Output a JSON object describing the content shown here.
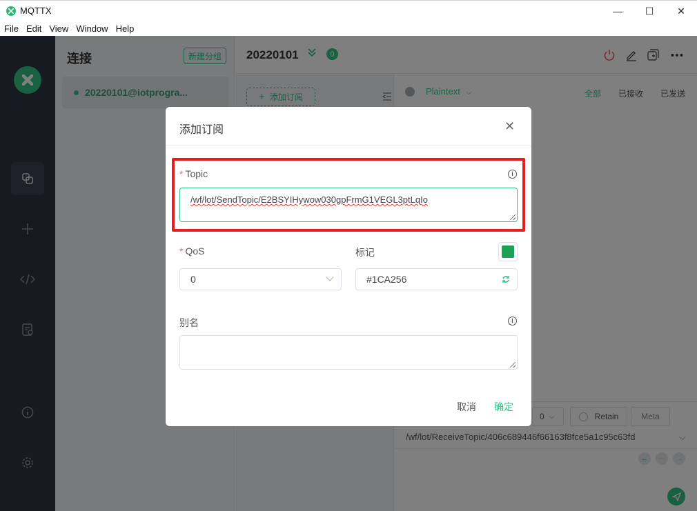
{
  "app": {
    "title": "MQTTX"
  },
  "window_controls": {
    "minimize": "—",
    "maximize": "☐",
    "close": "✕"
  },
  "menu": [
    "File",
    "Edit",
    "View",
    "Window",
    "Help"
  ],
  "connections": {
    "title": "连接",
    "new_group_label": "新建分组",
    "items": [
      {
        "name": "20220101@iotprogra...",
        "status_color": "#34c388"
      }
    ]
  },
  "main": {
    "title": "20220101",
    "subscription_count": "0",
    "add_subscription_label": "添加订阅",
    "payload_format": "Plaintext",
    "filters": [
      "全部",
      "已接收",
      "已发送"
    ],
    "composer": {
      "qos_value": "0",
      "retain_label": "Retain",
      "meta_label": "Meta",
      "topic": "/wf/lot/ReceiveTopic/406c689446f66163f8fce5a1c95c63fd"
    }
  },
  "dialog": {
    "title": "添加订阅",
    "topic_label": "Topic",
    "topic_value": "/wf/lot/SendTopic/E2BSYIHywow030gpFrmG1VEGL3ptLqIo",
    "qos_label": "QoS",
    "qos_value": "0",
    "color_label": "标记",
    "color_value": "#1CA256",
    "alias_label": "别名",
    "alias_value": "",
    "cancel_label": "取消",
    "confirm_label": "确定",
    "required_mark": "*"
  },
  "colors": {
    "accent": "#34c388",
    "highlight": "#e81e1e",
    "swatch": "#1CA256"
  },
  "icons": {
    "nav": [
      "connections-icon",
      "plus-icon",
      "code-icon",
      "log-icon",
      "info-icon",
      "settings-icon"
    ],
    "header": [
      "power-icon",
      "edit-icon",
      "new-window-icon",
      "more-icon"
    ]
  }
}
